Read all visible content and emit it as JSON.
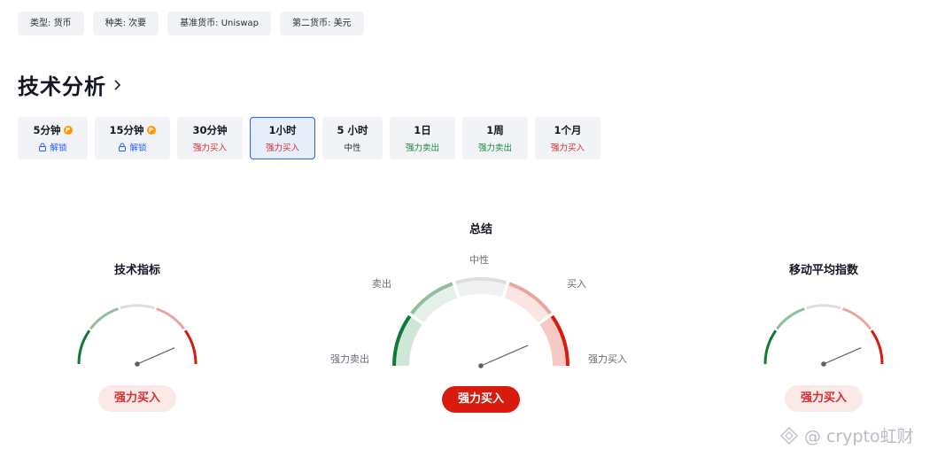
{
  "meta_chips": [
    {
      "label": "类型",
      "value": "货币"
    },
    {
      "label": "种类",
      "value": "次要"
    },
    {
      "label": "基准货币",
      "value": "Uniswap"
    },
    {
      "label": "第二货币",
      "value": "美元"
    }
  ],
  "section": {
    "title": "技术分析"
  },
  "tabs": [
    {
      "label": "5分钟",
      "status": "解锁",
      "locked": true,
      "active": false
    },
    {
      "label": "15分钟",
      "status": "解锁",
      "locked": true,
      "active": false
    },
    {
      "label": "30分钟",
      "status": "强力买入",
      "locked": false,
      "active": false
    },
    {
      "label": "1小时",
      "status": "强力买入",
      "locked": false,
      "active": true
    },
    {
      "label": "5 小时",
      "status": "中性",
      "locked": false,
      "active": false
    },
    {
      "label": "1日",
      "status": "强力卖出",
      "locked": false,
      "active": false
    },
    {
      "label": "1周",
      "status": "强力卖出",
      "locked": false,
      "active": false
    },
    {
      "label": "1个月",
      "status": "强力买入",
      "locked": false,
      "active": false
    }
  ],
  "gauges": {
    "technical": {
      "title": "技术指标",
      "result": "强力买入",
      "needle_level": 0.87
    },
    "summary": {
      "title": "总结",
      "result": "强力买入",
      "needle_level": 0.87,
      "labels": {
        "strong_sell": "强力卖出",
        "sell": "卖出",
        "neutral": "中性",
        "buy": "买入",
        "strong_buy": "强力买入"
      }
    },
    "moving_averages": {
      "title": "移动平均指数",
      "result": "强力买入",
      "needle_level": 0.87
    }
  },
  "colors": {
    "strong_sell": "#0f7a34",
    "sell": "#8fbf9c",
    "neutral": "#dcdee3",
    "buy": "#eba5a0",
    "strong_buy": "#d81b0c",
    "active_border": "#2962ff"
  },
  "watermark": {
    "text": "@ crypto虹财"
  }
}
